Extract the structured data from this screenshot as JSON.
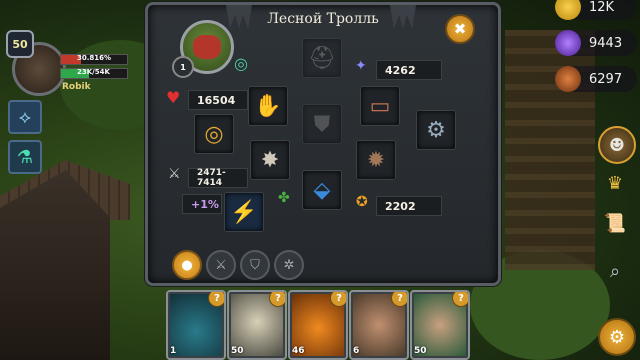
{
  "player": {
    "level": "50",
    "name": "Robik",
    "hp_percent_text": "30.816%",
    "hp_fraction": 0.308,
    "xp_text": "23K/54K",
    "xp_fraction": 0.43
  },
  "panel": {
    "title": "Лесной Тролль",
    "close_label": "✖",
    "creature_level": "1",
    "stats": {
      "armor": "4262",
      "health": "16504",
      "damage": "2471-7414",
      "bonus": "+1%",
      "power": "2202"
    },
    "tabs": [
      {
        "name": "profile",
        "icon": "person-icon",
        "active": true
      },
      {
        "name": "weapon",
        "icon": "sword-icon",
        "active": false
      },
      {
        "name": "shield",
        "icon": "shield-icon",
        "active": false
      },
      {
        "name": "skills",
        "icon": "gear-icon",
        "active": false
      }
    ]
  },
  "cards": [
    {
      "level": "1",
      "q": "?"
    },
    {
      "level": "50",
      "q": "?"
    },
    {
      "level": "46",
      "q": "?"
    },
    {
      "level": "6",
      "q": "?"
    },
    {
      "level": "50",
      "q": "?"
    }
  ],
  "resources": {
    "gold": "12K",
    "gems": "9443",
    "food": "6297"
  },
  "colors": {
    "gold": "#f0b23a",
    "gem": "#7a3ed0",
    "hp": "#c0392b",
    "xp": "#2ea84a"
  }
}
